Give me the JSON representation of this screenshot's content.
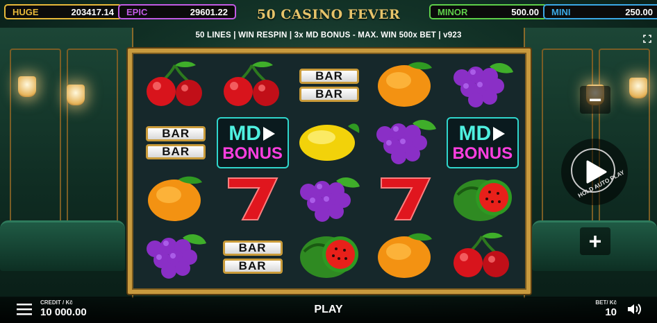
{
  "header": {
    "title": "50 CASINO FEVER",
    "subtitle": "50 LINES | WIN RESPIN | 3x MD BONUS - MAX. WIN 500x BET | v923"
  },
  "jackpots": [
    {
      "label": "HUGE",
      "value": "203417.14",
      "color": "#e8b93a"
    },
    {
      "label": "EPIC",
      "value": "29601.22",
      "color": "#c35be6"
    },
    {
      "label": "MINOR",
      "value": "500.00",
      "color": "#5ed04a"
    },
    {
      "label": "MINI",
      "value": "250.00",
      "color": "#3ba9e6"
    }
  ],
  "reels": [
    [
      "cherry",
      "cherry",
      "bar",
      "orange",
      "grapes"
    ],
    [
      "bar",
      "md-bonus",
      "lemon",
      "grapes",
      "md-bonus"
    ],
    [
      "orange",
      "seven",
      "grapes",
      "seven",
      "watermelon"
    ],
    [
      "grapes",
      "bar",
      "watermelon",
      "orange",
      "cherry"
    ]
  ],
  "symbols": {
    "bar_text": "BAR",
    "md_top": "MD",
    "md_bottom": "BONUS"
  },
  "controls": {
    "minus": "−",
    "plus": "+",
    "auto_label": "HOLD AUTO PLAY",
    "play_label": "PLAY",
    "credit_label": "CREDIT / Kč",
    "credit_value": "10 000.00",
    "bet_label": "BET/ Kč",
    "bet_value": "10"
  },
  "colors": {
    "frame_gold": "#c89a3e",
    "background_green": "#123227"
  }
}
